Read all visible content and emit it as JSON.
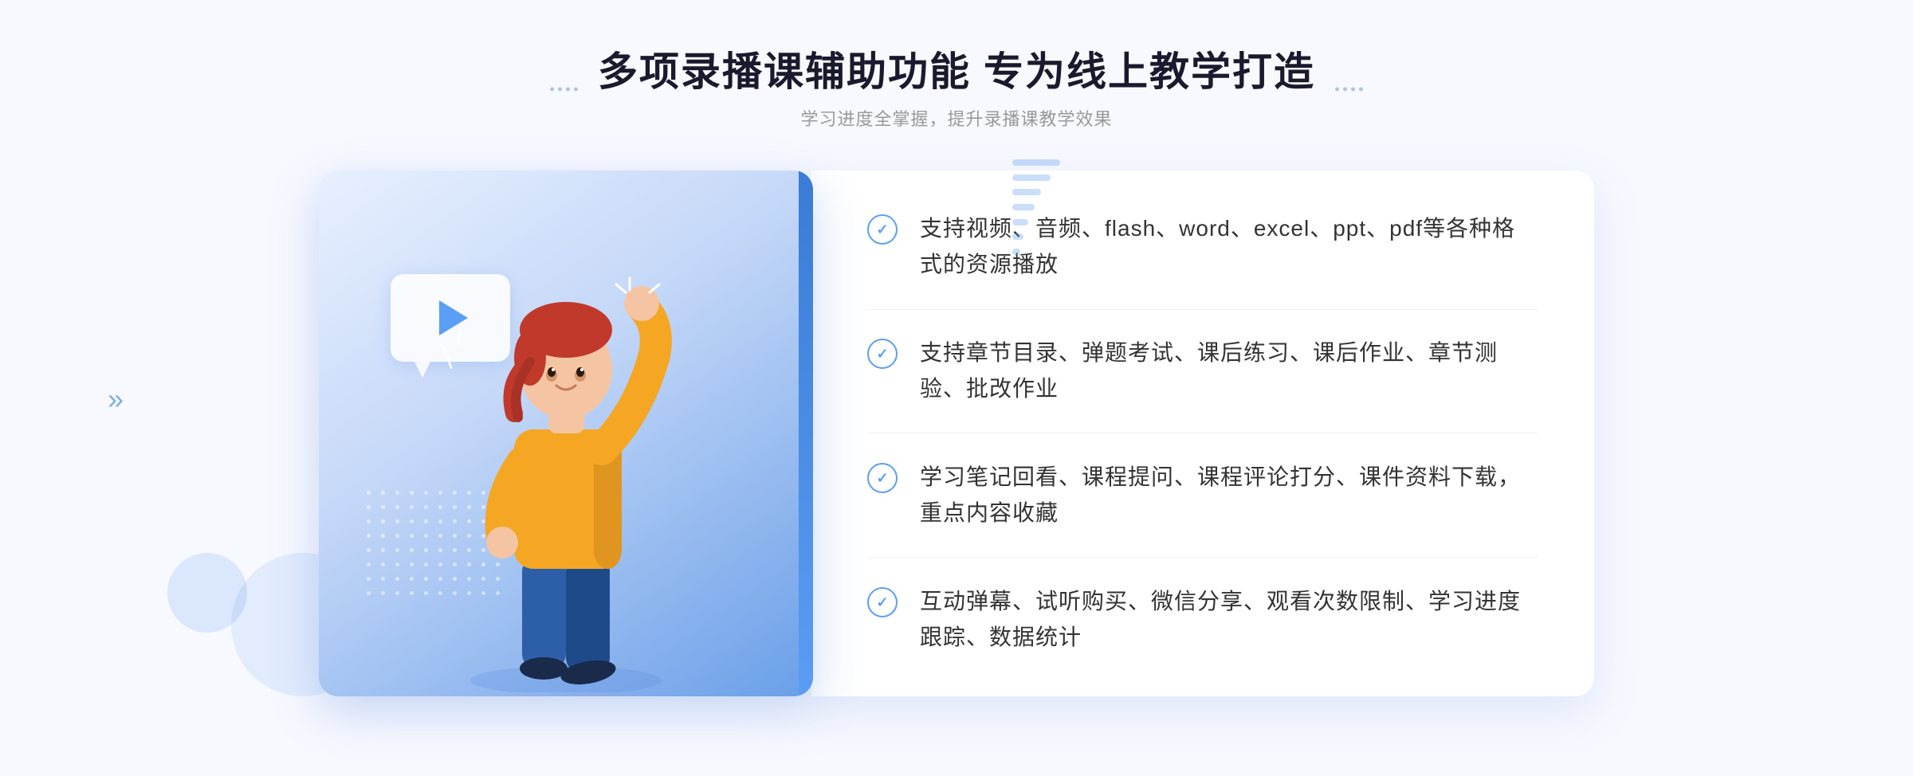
{
  "page": {
    "background": "#f8f9ff"
  },
  "header": {
    "main_title": "多项录播课辅助功能 专为线上教学打造",
    "subtitle": "学习进度全掌握，提升录播课教学效果"
  },
  "features": [
    {
      "id": 1,
      "text": "支持视频、音频、flash、word、excel、ppt、pdf等各种格式的资源播放"
    },
    {
      "id": 2,
      "text": "支持章节目录、弹题考试、课后练习、课后作业、章节测验、批改作业"
    },
    {
      "id": 3,
      "text": "学习笔记回看、课程提问、课程评论打分、课件资料下载，重点内容收藏"
    },
    {
      "id": 4,
      "text": "互动弹幕、试听购买、微信分享、观看次数限制、学习进度跟踪、数据统计"
    }
  ],
  "icons": {
    "play": "▶",
    "check": "✓",
    "chevron_left": "»"
  },
  "colors": {
    "primary_blue": "#5a9ff5",
    "dark_blue": "#3a7bd5",
    "title_color": "#1a1a2e",
    "text_color": "#333333",
    "subtitle_color": "#999999",
    "bg_color": "#f8f9ff",
    "white": "#ffffff",
    "divider": "#f0f0f0"
  }
}
